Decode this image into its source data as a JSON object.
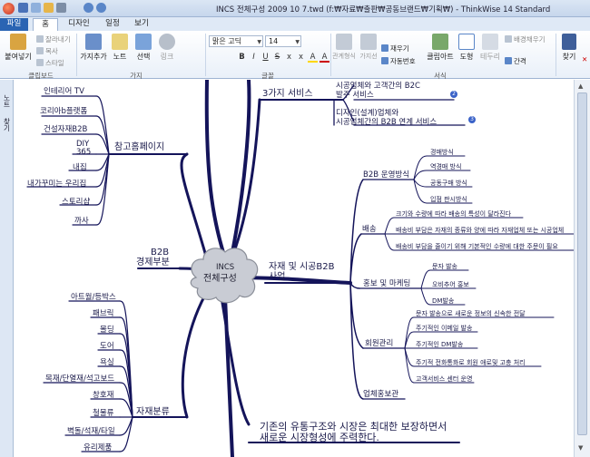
{
  "window": {
    "title": "INCS 전체구성 2009 10 7.twd (f:₩자료₩출판₩공동브랜드₩기획₩) - ThinkWise 14 Standard"
  },
  "tabs": [
    "파일",
    "홈",
    "디자인",
    "일정",
    "보기"
  ],
  "ribbon": {
    "clipboard": {
      "paste": "붙여넣기",
      "cut": "잘라내기",
      "copy": "복사",
      "style": "스타일",
      "label": "클립보드"
    },
    "branch": {
      "add_branch": "가지추가",
      "note": "노트",
      "select": "선택",
      "link": "링크",
      "label": "가지"
    },
    "font": {
      "family": "맑은 고딕",
      "size": "14",
      "label": "글꼴"
    },
    "format": {
      "relation": "관계형식",
      "branch_shape": "가지선",
      "align": "재우기",
      "auto_number": "자동번호",
      "clipart": "클립아트",
      "shape": "도형",
      "border": "테두리",
      "bg_fill": "배경채우기",
      "spacing": "간격",
      "label": "서식"
    },
    "find": {
      "label": "찾기"
    },
    "format_buttons": [
      "B",
      "I",
      "U",
      "S",
      "x",
      "x",
      "A",
      "A"
    ]
  },
  "leftbar": {
    "tab1": "노트",
    "tab2": "찾기"
  },
  "mindmap": {
    "center": {
      "line1": "INCS",
      "line2": "전체구성"
    },
    "main_topics": [
      {
        "text": "3가지 서비스"
      },
      {
        "line1": "자재 및 시공B2B",
        "line2": "사업"
      },
      {
        "text": "참고홈페이지"
      },
      {
        "line1": "B2B",
        "line2": "경제부분"
      },
      {
        "text": "자재분류"
      },
      {
        "line1": "기존의 유통구조와 시장은 최대한 보장하면서",
        "line2": "새로운 시장형성에 주력한다."
      }
    ],
    "services": [
      {
        "line1": "시공업체와 고객간의 B2C",
        "line2": "발주 서비스",
        "badge": "2"
      },
      {
        "line1": "디자인(설계)업체와",
        "line2": "시공업체간의 B2B 연계 서비스",
        "badge": "3"
      }
    ],
    "b2b_topics": [
      "B2B 운영방식",
      "배송",
      "홍보 및 마케팅",
      "회원관리",
      "업체홍보관"
    ],
    "b2b_ops": [
      "경매방식",
      "역경매 방식",
      "공동구매 방식",
      "입점 판시방식"
    ],
    "delivery": [
      "크기와 수량에 따라 배송의 특성이 달라진다",
      "배송비 부담은 자재의 종류와 양에 따라 자재업체 또는 시공업체",
      "배송비 부담을 줄이기 위해 기본적인 수량에 대한 주문이 필요"
    ],
    "promo": [
      "문자 발송",
      "오비추어 홍보",
      "DM발송"
    ],
    "members": [
      "문자 발송으로 새로운 정보의 신속한 전달",
      "주기적인 이메일 발송",
      "주기적인 DM발송",
      "주기적 전화통화로 회원 애로및 고충 처리",
      "고객서비스 센터 운영"
    ],
    "homepages": [
      "인테리어 TV",
      "코리아b플랫폼",
      "건설자재B2B",
      "DIY",
      "365",
      "내집",
      "내가꾸미는 우리집",
      "스토리샵",
      "까사"
    ],
    "materials": [
      "아트월/등박스",
      "패브릭",
      "몰딩",
      "도어",
      "욕실",
      "목재/단열재/석고보드",
      "창호재",
      "철물류",
      "벽돌/석재/타일",
      "유리제품"
    ]
  }
}
